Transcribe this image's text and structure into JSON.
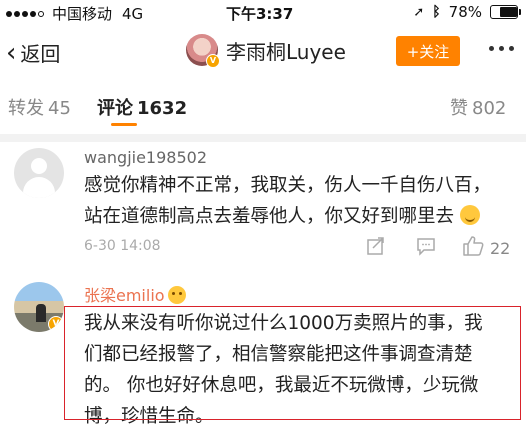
{
  "status_bar": {
    "carrier": "中国移动",
    "network": "4G",
    "time": "下午3:37",
    "battery_percent": "78%",
    "battery_level": 0.78
  },
  "nav": {
    "back_label": "返回",
    "title": "李雨桐Luyee",
    "follow_label": "+关注"
  },
  "tabs": {
    "repost": {
      "label": "转发",
      "count": "45"
    },
    "comments": {
      "label": "评论",
      "count": "1632"
    },
    "likes": {
      "label": "赞",
      "count": "802"
    }
  },
  "comments": [
    {
      "username": "wangjie198502",
      "lines": [
        "感觉你精神不正常，我取关，伤人一千自伤八百，",
        "站在道德制高点去羞辱他人，你又好到哪里去"
      ],
      "date": "6-30 14:08",
      "like_count": "22"
    },
    {
      "username": "张梁emilio",
      "lines": [
        "我从来没有听你说过什么1000万卖照片的事，我",
        "们都已经报警了，相信警察能把这件事调查清楚",
        "的。 你也好好休息吧，我最近不玩微博，少玩微",
        "博，珍惜生命。"
      ]
    }
  ],
  "colors": {
    "accent": "#ff8200",
    "highlight_border": "#d9232b",
    "username_orange": "#eb7350"
  }
}
